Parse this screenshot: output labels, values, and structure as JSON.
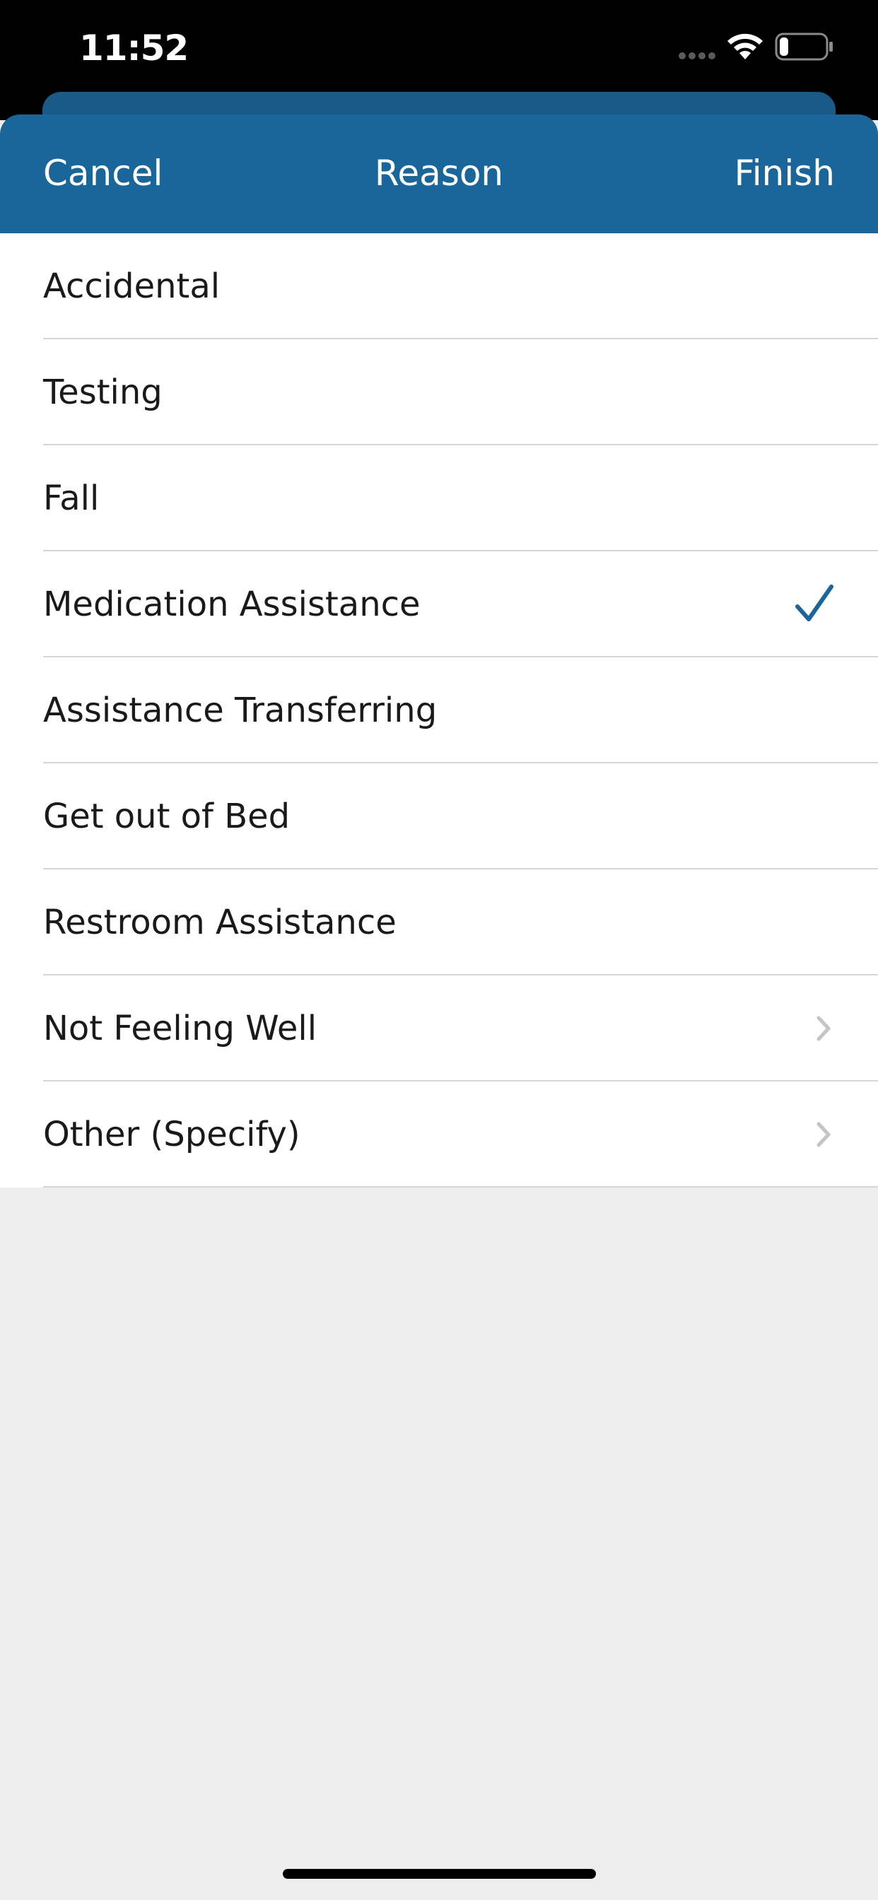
{
  "status_bar": {
    "time": "11:52",
    "signal_icon": "signal-dots-icon",
    "wifi_icon": "wifi-icon",
    "battery_icon": "battery-low-icon"
  },
  "nav": {
    "cancel_label": "Cancel",
    "title": "Reason",
    "finish_label": "Finish"
  },
  "reasons": [
    {
      "label": "Accidental",
      "accessory": "none"
    },
    {
      "label": "Testing",
      "accessory": "none"
    },
    {
      "label": "Fall",
      "accessory": "none"
    },
    {
      "label": "Medication Assistance",
      "accessory": "checkmark"
    },
    {
      "label": "Assistance Transferring",
      "accessory": "none"
    },
    {
      "label": "Get out of Bed",
      "accessory": "none"
    },
    {
      "label": "Restroom Assistance",
      "accessory": "none"
    },
    {
      "label": "Not Feeling Well",
      "accessory": "chevron"
    },
    {
      "label": "Other (Specify)",
      "accessory": "chevron"
    }
  ],
  "colors": {
    "nav_background": "#1a6599",
    "accent": "#1a6599",
    "list_background": "#ffffff",
    "page_background": "#ededed",
    "separator": "#d6d6d6",
    "chevron": "#c4c4c7"
  }
}
